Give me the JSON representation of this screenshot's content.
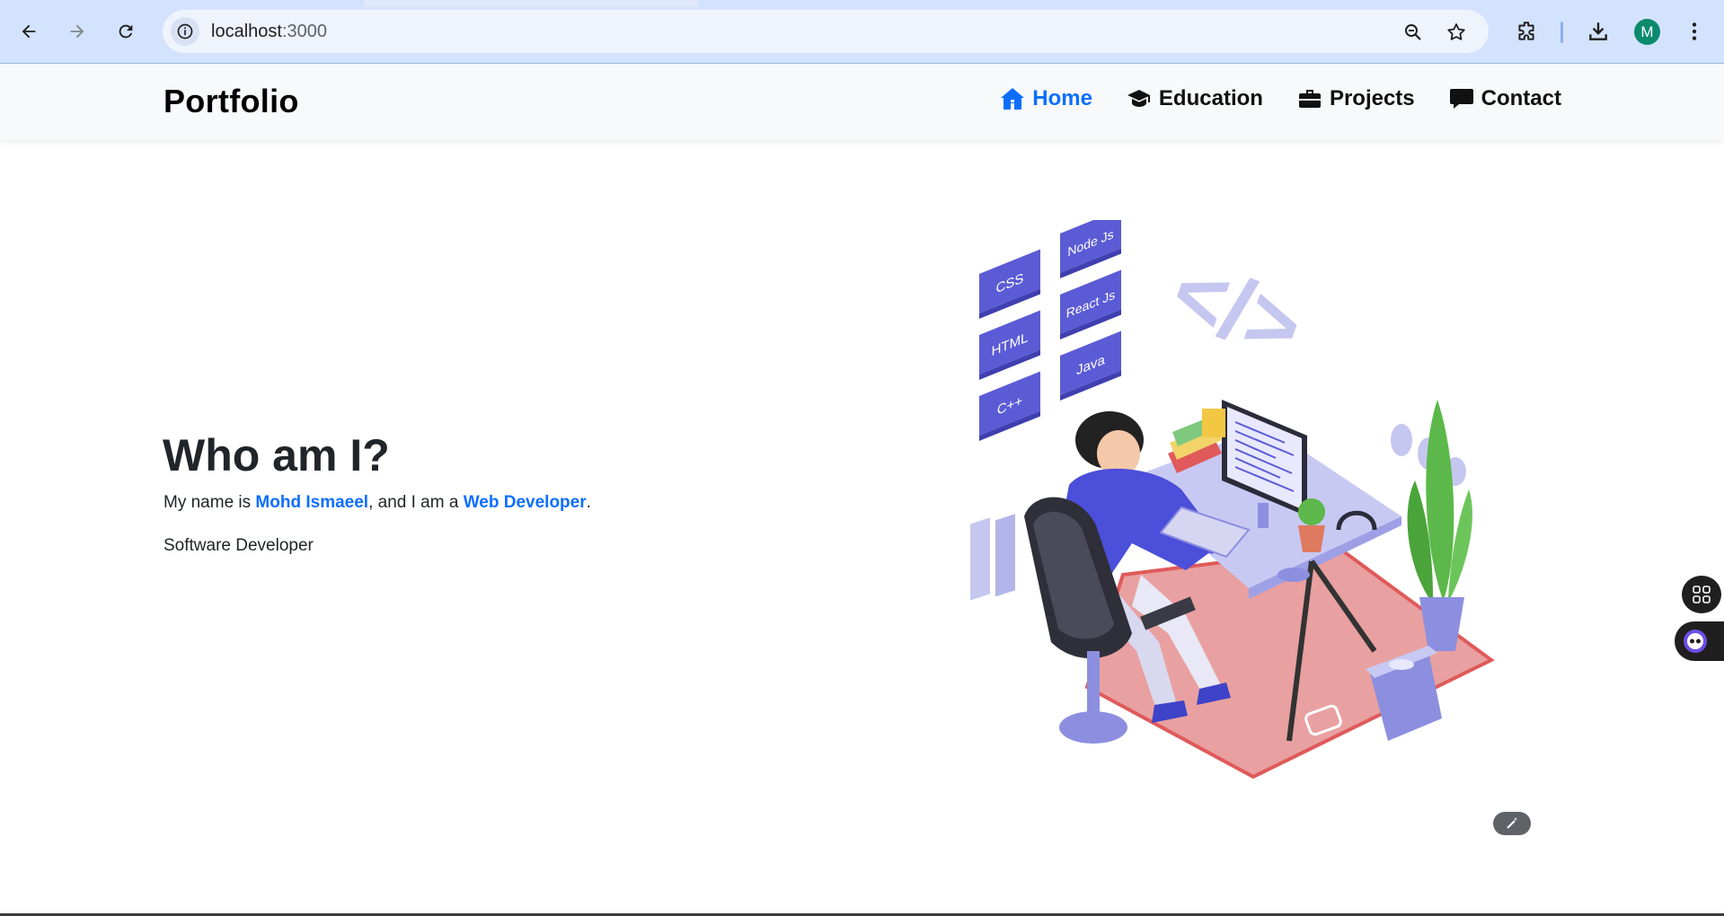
{
  "browser": {
    "url_host": "localhost",
    "url_port": ":3000",
    "profile_initial": "M"
  },
  "navbar": {
    "brand": "Portfolio",
    "links": [
      {
        "label": "Home",
        "icon": "house-icon",
        "active": true
      },
      {
        "label": "Education",
        "icon": "graduation-cap-icon",
        "active": false
      },
      {
        "label": "Projects",
        "icon": "briefcase-icon",
        "active": false
      },
      {
        "label": "Contact",
        "icon": "chat-bubble-icon",
        "active": false
      }
    ]
  },
  "hero": {
    "title": "Who am I?",
    "line_prefix": "My name is ",
    "name": "Mohd Ismaeel",
    "line_middle": ", and I am a ",
    "role": "Web Developer",
    "line_suffix": ".",
    "subtitle": "Software Developer"
  },
  "illustration": {
    "tiles": [
      "CSS",
      "Node Js",
      "HTML",
      "React Js",
      "C++",
      "Java"
    ],
    "code_symbol": "</>"
  },
  "colors": {
    "accent": "#0d6efd",
    "chrome": "#d3e3fd",
    "navbar": "#f8f9fa",
    "illustration_purple": "#5b5bd6",
    "rug": "#e88a8a"
  }
}
